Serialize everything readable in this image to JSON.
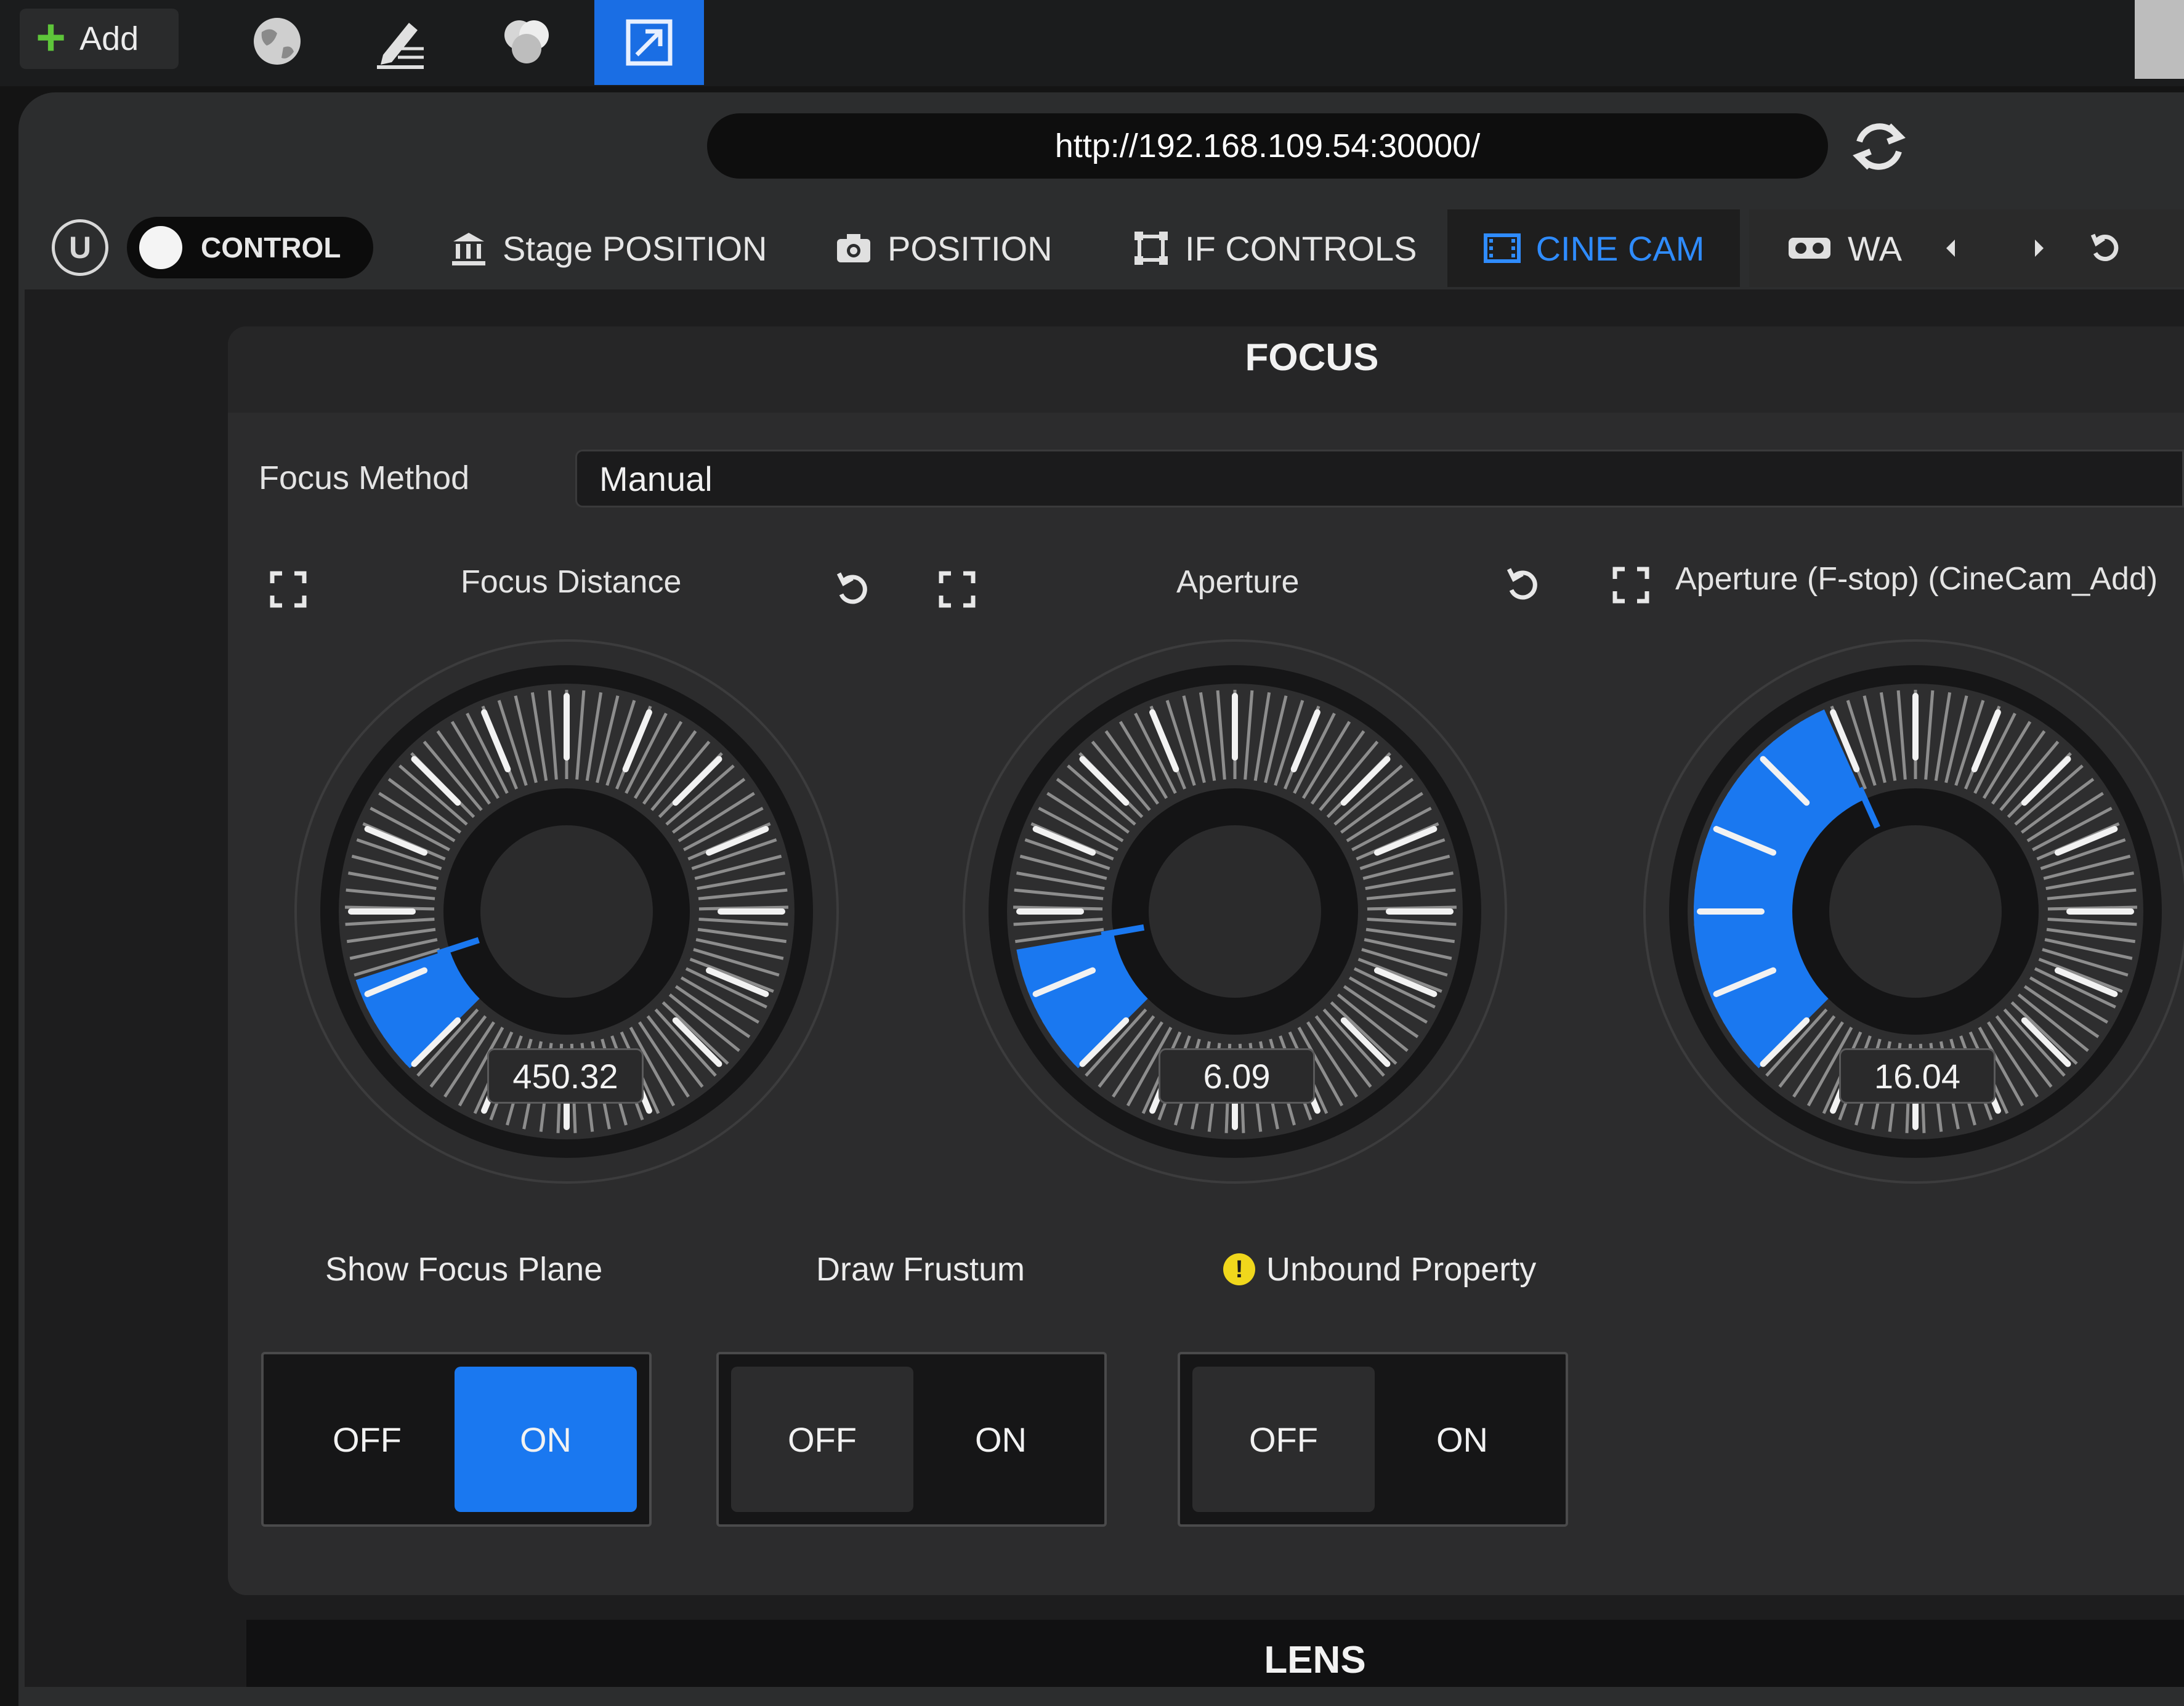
{
  "toolbar": {
    "add_label": "Add",
    "tools": [
      "globe-icon",
      "edit-icon",
      "color-icon",
      "external-link-icon"
    ]
  },
  "browser": {
    "url": "http://192.168.109.54:30000/"
  },
  "nav": {
    "control_label": "CONTROL",
    "tabs": [
      {
        "label": "Stage POSITION",
        "icon": "building-icon"
      },
      {
        "label": "POSITION",
        "icon": "camera-icon"
      },
      {
        "label": "IF CONTROLS",
        "icon": "frame-icon"
      },
      {
        "label": "CINE CAM",
        "icon": "film-icon",
        "active": true
      },
      {
        "label": "WA",
        "icon": "vr-headset-icon"
      }
    ]
  },
  "colors": {
    "accent": "#1a78f0",
    "active_tab_text": "#2f8cff",
    "warning": "#f0d71c"
  },
  "focus": {
    "title": "FOCUS",
    "method_label": "Focus Method",
    "method_value": "Manual",
    "dials": [
      {
        "title": "Focus Distance",
        "value": "450.32",
        "level": 0.1
      },
      {
        "title": "Aperture",
        "value": "6.09",
        "level": 0.13
      },
      {
        "title": "Aperture (F-stop) (CineCam_Add)",
        "value": "16.04",
        "level": 0.41
      }
    ],
    "properties": [
      {
        "label": "Show Focus Plane",
        "off": "OFF",
        "on": "ON",
        "selected": "on",
        "warning": false
      },
      {
        "label": "Draw Frustum",
        "off": "OFF",
        "on": "ON",
        "selected": "off",
        "warning": false
      },
      {
        "label": "Unbound Property",
        "off": "OFF",
        "on": "ON",
        "selected": "off",
        "warning": true,
        "warning_glyph": "!"
      }
    ]
  },
  "lens": {
    "title": "LENS"
  }
}
